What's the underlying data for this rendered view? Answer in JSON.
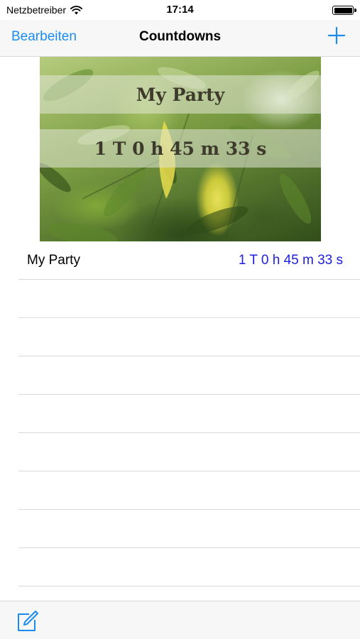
{
  "status_bar": {
    "carrier": "Netzbetreiber",
    "time": "17:14"
  },
  "nav": {
    "edit_label": "Bearbeiten",
    "title": "Countdowns",
    "add_icon": "plus-icon"
  },
  "hero": {
    "title": "My Party",
    "countdown": "1 T 0 h 45 m 33 s"
  },
  "list": {
    "items": [
      {
        "name": "My Party",
        "remaining": "1 T 0 h 45 m 33 s"
      }
    ]
  },
  "toolbar": {
    "compose_icon": "compose-icon"
  },
  "colors": {
    "accent": "#1a8cf0",
    "countdown_value": "#1d1ee0"
  }
}
